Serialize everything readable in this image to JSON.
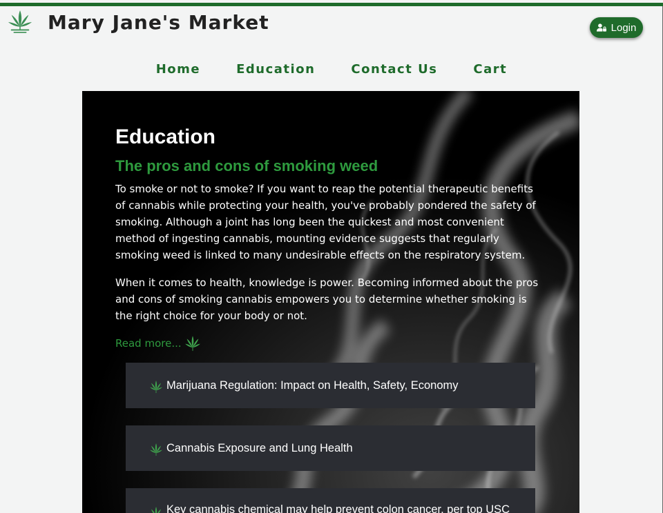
{
  "header": {
    "site_title": "Mary Jane's Market",
    "login_label": "Login"
  },
  "nav": {
    "items": [
      "Home",
      "Education",
      "Contact Us",
      "Cart"
    ]
  },
  "main": {
    "heading": "Education",
    "article_title": "The pros and cons of smoking weed",
    "paragraph_1": "To smoke or not to smoke? If you want to reap the potential therapeutic benefits of cannabis while protecting your health, you've probably pondered the safety of smoking. Although a joint has long been the quickest and most convenient method of ingesting cannabis, mounting evidence suggests that regularly smoking weed is linked to many undesirable effects on the respiratory system.",
    "paragraph_2": "When it comes to health, knowledge is power. Becoming informed about the pros and cons of smoking cannabis empowers you to determine whether smoking is the right choice for your body or not.",
    "read_more": "Read more...",
    "articles": [
      "Marijuana Regulation: Impact on Health, Safety, Economy",
      "Cannabis Exposure and Lung Health",
      "Key cannabis chemical may help prevent colon cancer, per top USC"
    ]
  },
  "colors": {
    "brand_green": "#1e6b2b",
    "accent_green": "#2e9a3e",
    "card_bg": "#2b2d33"
  },
  "icons": {
    "logo": "cannabis-leaf-logo",
    "login": "user-lock-icon",
    "leaf": "cannabis-leaf-icon"
  }
}
